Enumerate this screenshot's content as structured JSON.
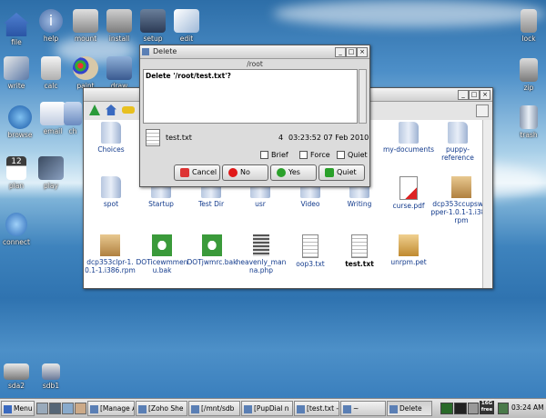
{
  "desktop_icons": [
    {
      "label": "file",
      "icon": "home-icon"
    },
    {
      "label": "help",
      "icon": "help-icon"
    },
    {
      "label": "mount",
      "icon": "drive-icon"
    },
    {
      "label": "install",
      "icon": "install-icon"
    },
    {
      "label": "setup",
      "icon": "setup-icon"
    },
    {
      "label": "edit",
      "icon": "edit-icon"
    },
    {
      "label": "lock",
      "icon": "lock-icon"
    },
    {
      "label": "write",
      "icon": "write-icon"
    },
    {
      "label": "calc",
      "icon": "calc-icon"
    },
    {
      "label": "paint",
      "icon": "paint-icon"
    },
    {
      "label": "draw",
      "icon": "draw-icon"
    },
    {
      "label": "zip",
      "icon": "zip-icon"
    },
    {
      "label": "browse",
      "icon": "browse-icon"
    },
    {
      "label": "email",
      "icon": "email-icon"
    },
    {
      "label": "ch",
      "icon": "chat-icon"
    },
    {
      "label": "trash",
      "icon": "trash-icon"
    },
    {
      "label": "plan",
      "icon": "calendar-icon"
    },
    {
      "label": "play",
      "icon": "play-icon"
    },
    {
      "label": "connect",
      "icon": "connect-icon"
    },
    {
      "label": "sda2",
      "icon": "disk-icon"
    },
    {
      "label": "sdb1",
      "icon": "usb-icon"
    }
  ],
  "file_window": {
    "title": "~",
    "items": [
      {
        "label": "Choices",
        "type": "folder"
      },
      {
        "label": "ons",
        "type": "folder"
      },
      {
        "label": "my-documents",
        "type": "folder"
      },
      {
        "label": "puppy-reference",
        "type": "folder"
      },
      {
        "label": "spot",
        "type": "folder"
      },
      {
        "label": "Startup",
        "type": "folder"
      },
      {
        "label": "Test Dir",
        "type": "folder"
      },
      {
        "label": "usr",
        "type": "folder"
      },
      {
        "label": "Video",
        "type": "folder"
      },
      {
        "label": "Writing",
        "type": "folder"
      },
      {
        "label": "curse.pdf",
        "type": "pdf"
      },
      {
        "label": "dcp353ccupswrapper-1.0.1-1.i386.rpm",
        "type": "package"
      },
      {
        "label": "dcp353clpr-1.0.1-1.i386.rpm",
        "type": "package"
      },
      {
        "label": "DOTicewmmenu.bak",
        "type": "recycle"
      },
      {
        "label": "DOTjwmrc.bak",
        "type": "recycle"
      },
      {
        "label": "heavenly_manna.php",
        "type": "binary"
      },
      {
        "label": "oop3.txt",
        "type": "text"
      },
      {
        "label": "test.txt",
        "type": "text",
        "selected": true
      },
      {
        "label": "unrpm.pet",
        "type": "pet"
      }
    ]
  },
  "delete_dialog": {
    "title": "Delete",
    "path_title": "/root",
    "message": "Delete '/root/test.txt'?",
    "file_name": "test.txt",
    "file_size": "4",
    "file_date": "03:23:52 07 Feb 2010",
    "options": [
      "Brief",
      "Force",
      "Quiet"
    ],
    "buttons": {
      "cancel": "Cancel",
      "no": "No",
      "yes": "Yes",
      "quiet": "Quiet"
    }
  },
  "taskbar": {
    "menu_label": "Menu",
    "tasks": [
      "[Manage A",
      "[Zoho She",
      "[/mnt/sdb",
      "[PupDial n",
      "[test.txt -",
      "~",
      "Delete"
    ],
    "clock": "03:24 AM",
    "badge": "16G free"
  },
  "colors": {
    "accent": "#3a7fbd",
    "taskbar": "#d0d0d0",
    "link": "#123a8c"
  }
}
